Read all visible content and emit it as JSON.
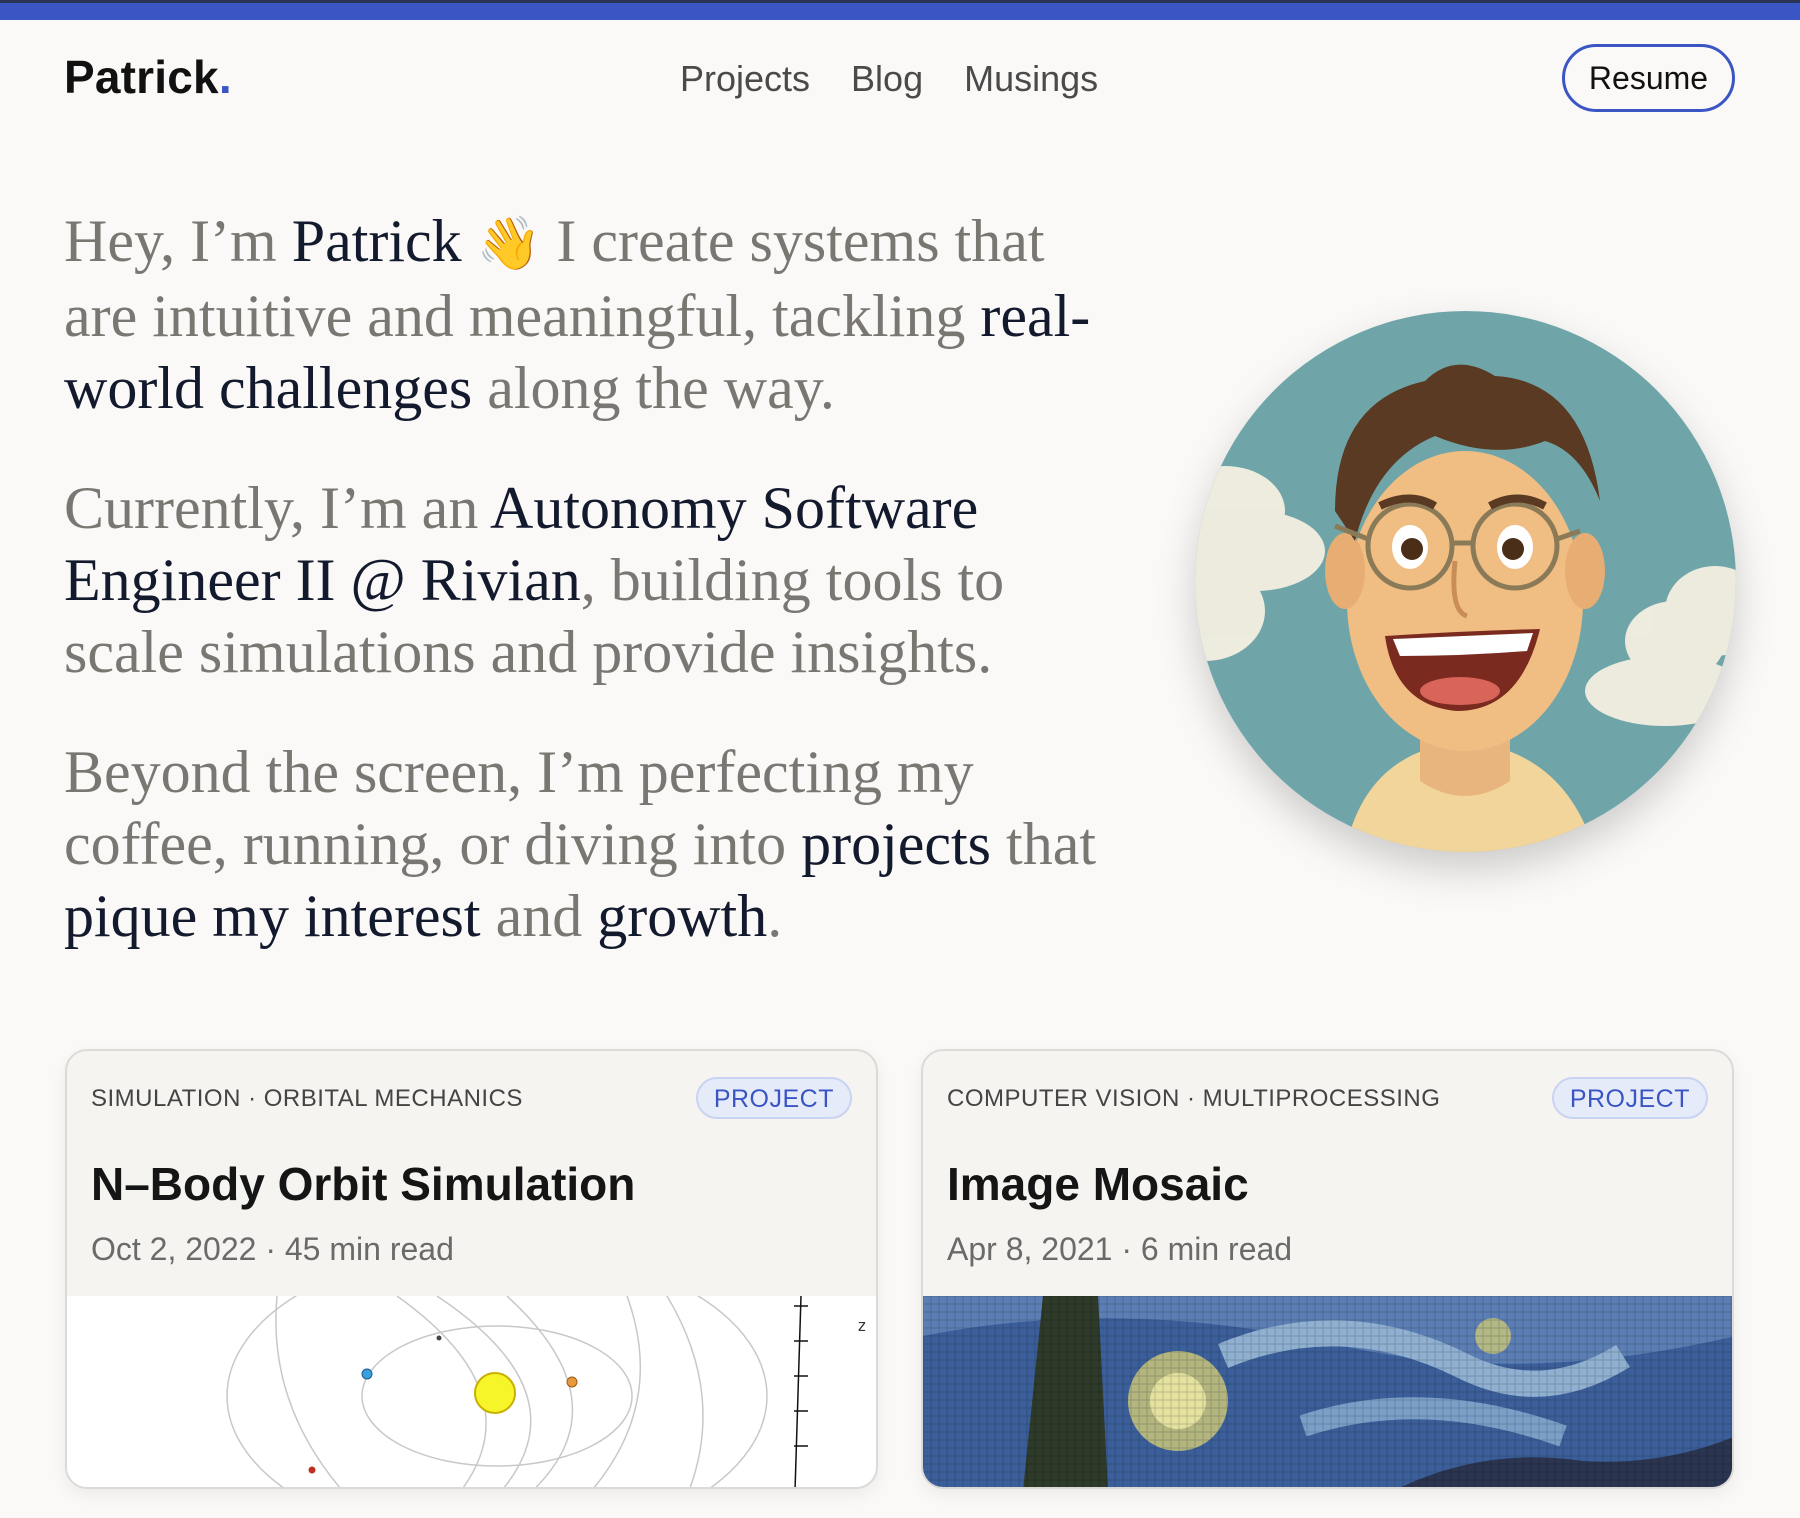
{
  "brand": {
    "name": "Patrick",
    "dot": "."
  },
  "nav": {
    "items": [
      "Projects",
      "Blog",
      "Musings"
    ],
    "resume_label": "Resume"
  },
  "hero": {
    "p1": [
      "Hey, I’m ",
      "Patrick",
      " ",
      "👋",
      " I create systems that are intuitive and meaningful, tackling ",
      "real-world challenges",
      " along the way."
    ],
    "p2": [
      "Currently, I’m an ",
      "Autonomy Software Engineer II @ Rivian",
      ", building tools to scale simulations and provide insights."
    ],
    "p3": [
      "Beyond the screen, I’m perfecting my coffee, running, or diving into ",
      "projects",
      " that ",
      "pique my interest",
      " and ",
      "growth",
      "."
    ]
  },
  "cards": [
    {
      "tags": "SIMULATION · ORBITAL MECHANICS",
      "badge": "PROJECT",
      "title": "N–Body Orbit Simulation",
      "meta": "Oct 2, 2022 · 45 min read",
      "thumb_axis_label": "z"
    },
    {
      "tags": "COMPUTER VISION · MULTIPROCESSING",
      "badge": "PROJECT",
      "title": "Image Mosaic",
      "meta": "Apr 8, 2021 · 6 min read"
    }
  ],
  "colors": {
    "accent": "#3a55c4",
    "badge_bg": "#e6ebfa",
    "text_muted": "#7a7672",
    "text_strong": "#141a2e"
  }
}
